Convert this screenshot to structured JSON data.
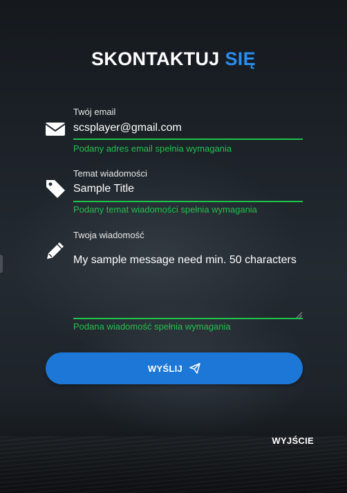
{
  "header": {
    "title_main": "SKONTAKTUJ",
    "title_accent": "SIĘ",
    "accent_color": "#2a8df0"
  },
  "form": {
    "email": {
      "icon": "envelope-icon",
      "label": "Twój email",
      "value": "scsplayer@gmail.com",
      "hint": "Podany adres email spełnia wymagania"
    },
    "subject": {
      "icon": "tag-icon",
      "label": "Temat wiadomości",
      "value": "Sample Title",
      "hint": "Podany temat wiadomości spełnia wymagania"
    },
    "message": {
      "icon": "pencil-icon",
      "label": "Twoja wiadomość",
      "value": "My sample message need min. 50 characters",
      "hint": "Podana wiadomość spełnia wymagania"
    },
    "valid_color": "#1fc44a"
  },
  "actions": {
    "send_label": "WYŚLIJ",
    "send_icon": "paper-plane-icon",
    "exit_label": "WYJŚCIE",
    "button_color": "#1d77d6"
  }
}
